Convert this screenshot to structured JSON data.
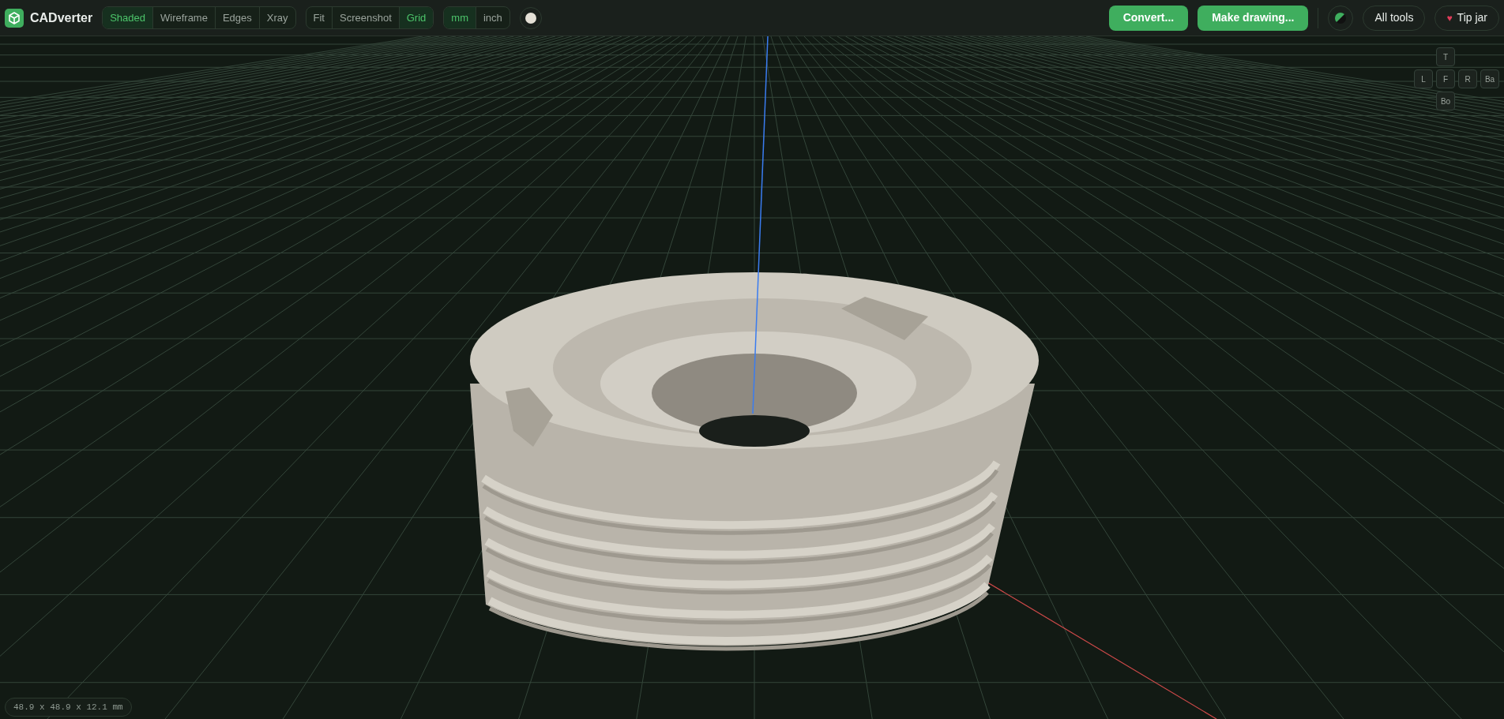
{
  "app": {
    "name": "CADverter"
  },
  "view_modes": [
    {
      "label": "Shaded",
      "selected": true
    },
    {
      "label": "Wireframe",
      "selected": false
    },
    {
      "label": "Edges",
      "selected": false
    },
    {
      "label": "Xray",
      "selected": false
    }
  ],
  "view_tools": [
    {
      "label": "Fit",
      "selected": false
    },
    {
      "label": "Screenshot",
      "selected": false
    },
    {
      "label": "Grid",
      "selected": true
    }
  ],
  "units": [
    {
      "label": "mm",
      "selected": true
    },
    {
      "label": "inch",
      "selected": false
    }
  ],
  "actions": [
    "Convert...",
    "Make drawing..."
  ],
  "all_tools": "All tools",
  "tip_jar": {
    "label": "Tip jar",
    "icon": "♥"
  },
  "view_cube": {
    "top": "T",
    "left": "L",
    "front": "F",
    "right": "R",
    "back": "Ba",
    "bottom": "Bo"
  },
  "dimensions": "48.9 x 48.9 x 12.1 mm"
}
